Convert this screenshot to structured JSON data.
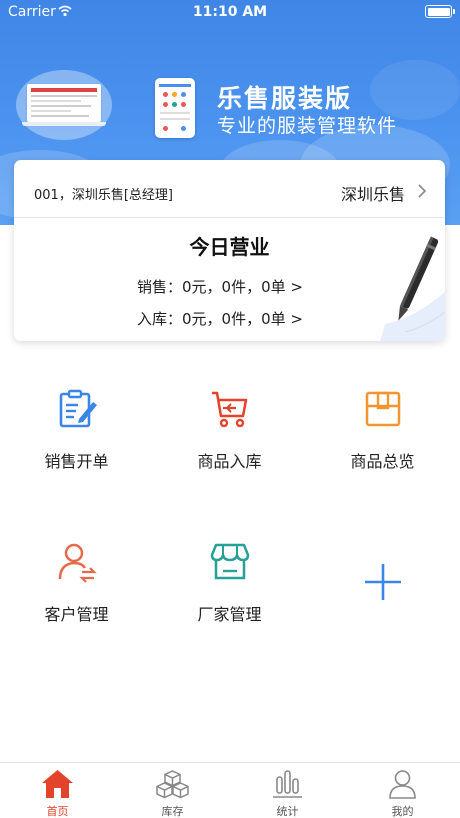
{
  "status_bar": {
    "carrier": "Carrier",
    "time": "11:10 AM"
  },
  "banner": {
    "title": "乐售服装版",
    "subtitle": "专业的服装管理软件"
  },
  "account": {
    "user": "001，深圳乐售[总经理]",
    "shop": "深圳乐售"
  },
  "today": {
    "title": "今日营业",
    "sales": "销售：0元，0件，0单 >",
    "inbound": "入库：0元，0件，0单 >"
  },
  "grid": {
    "sales_order": "销售开单",
    "goods_inbound": "商品入库",
    "goods_overview": "商品总览",
    "customer_manage": "客户管理",
    "vendor_manage": "厂家管理"
  },
  "tabs": {
    "home": "首页",
    "inventory": "库存",
    "stats": "统计",
    "mine": "我的"
  },
  "colors": {
    "accent_blue": "#4a8ff0",
    "accent_red": "#e3432a",
    "accent_orange": "#f2952e",
    "accent_teal": "#27a096"
  },
  "icons": {
    "sales_order": "clipboard-pen-icon",
    "goods_inbound": "cart-icon",
    "goods_overview": "box-icon",
    "customer_manage": "user-swap-icon",
    "vendor_manage": "shop-icon",
    "add": "plus-icon"
  }
}
